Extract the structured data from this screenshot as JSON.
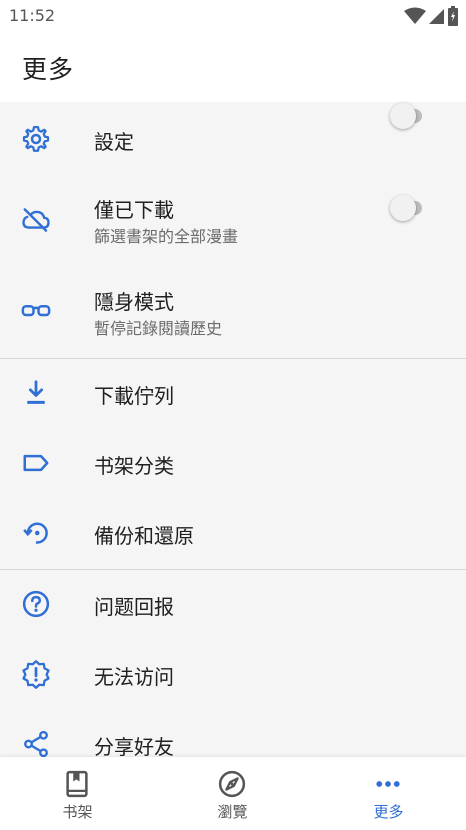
{
  "status_bar": {
    "time": "11:52"
  },
  "app_bar": {
    "title": "更多"
  },
  "menu": {
    "settings": {
      "label": "設定"
    },
    "downloaded_only": {
      "label": "僅已下載",
      "subtitle": "篩選書架的全部漫畫",
      "enabled": false
    },
    "incognito": {
      "label": "隱身模式",
      "subtitle": "暫停記錄閱讀歷史",
      "enabled": false
    },
    "download_queue": {
      "label": "下載佇列"
    },
    "categories": {
      "label": "书架分类"
    },
    "backup": {
      "label": "備份和還原"
    },
    "feedback": {
      "label": "问题回报"
    },
    "cannot_access": {
      "label": "无法访问"
    },
    "share": {
      "label": "分享好友"
    }
  },
  "bottom_nav": {
    "items": [
      {
        "label": "书架",
        "icon": "book-icon",
        "active": false
      },
      {
        "label": "瀏覽",
        "icon": "compass-icon",
        "active": false
      },
      {
        "label": "更多",
        "icon": "more-dots-icon",
        "active": true
      }
    ]
  },
  "colors": {
    "accent": "#2f6fd6",
    "background": "#f5f5f5",
    "text": "#202020",
    "subtext": "#6b6b6b"
  }
}
